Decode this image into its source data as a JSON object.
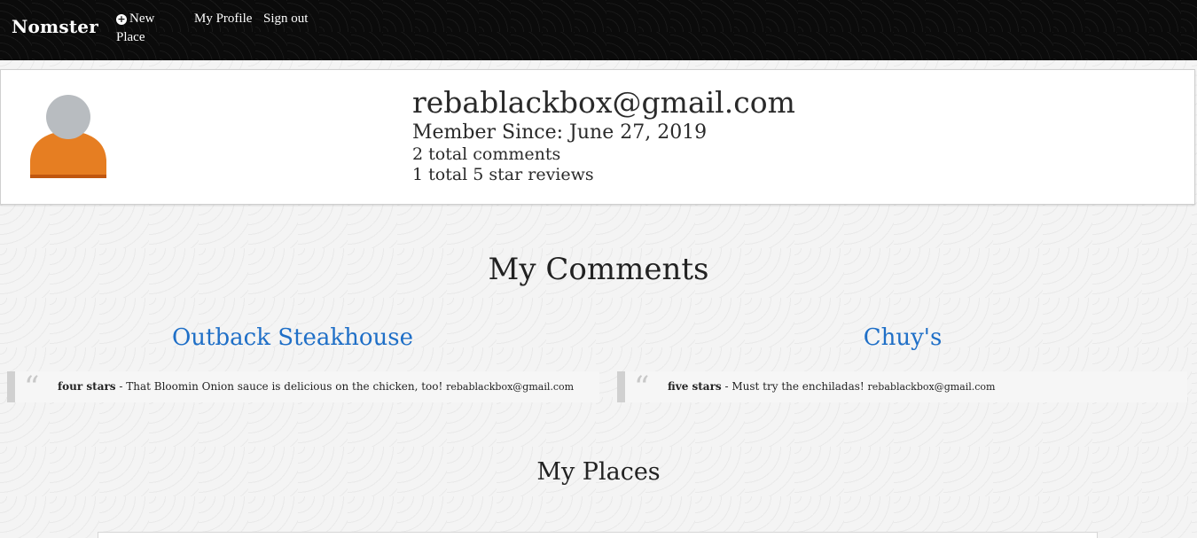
{
  "navbar": {
    "brand": "Nomster",
    "new_place": "New Place",
    "my_profile": "My Profile",
    "sign_out": "Sign out",
    "icons": {
      "new_place_icon": "plus-circle-icon"
    }
  },
  "profile": {
    "email": "rebablackbox@gmail.com",
    "member_since": "Member Since: June 27, 2019",
    "total_comments": "2 total comments",
    "five_star_reviews": "1 total 5 star reviews",
    "avatar_icon": "user-avatar-icon",
    "colors": {
      "avatar_head": "#b8bcc0",
      "avatar_body": "#e67e22",
      "avatar_body_shadow": "#c0570f"
    }
  },
  "comments": {
    "title": "My Comments",
    "items": [
      {
        "place": "Outback Steakhouse",
        "rating": "four stars",
        "text": " - That Bloomin Onion sauce is delicious on the chicken, too! ",
        "user": "rebablackbox@gmail.com"
      },
      {
        "place": "Chuy's",
        "rating": "five stars",
        "text": " - Must try the enchiladas! ",
        "user": "rebablackbox@gmail.com"
      }
    ]
  },
  "places": {
    "title": "My Places"
  },
  "colors": {
    "link": "#1f6fc7",
    "navbar_bg": "#0b0b0b"
  }
}
